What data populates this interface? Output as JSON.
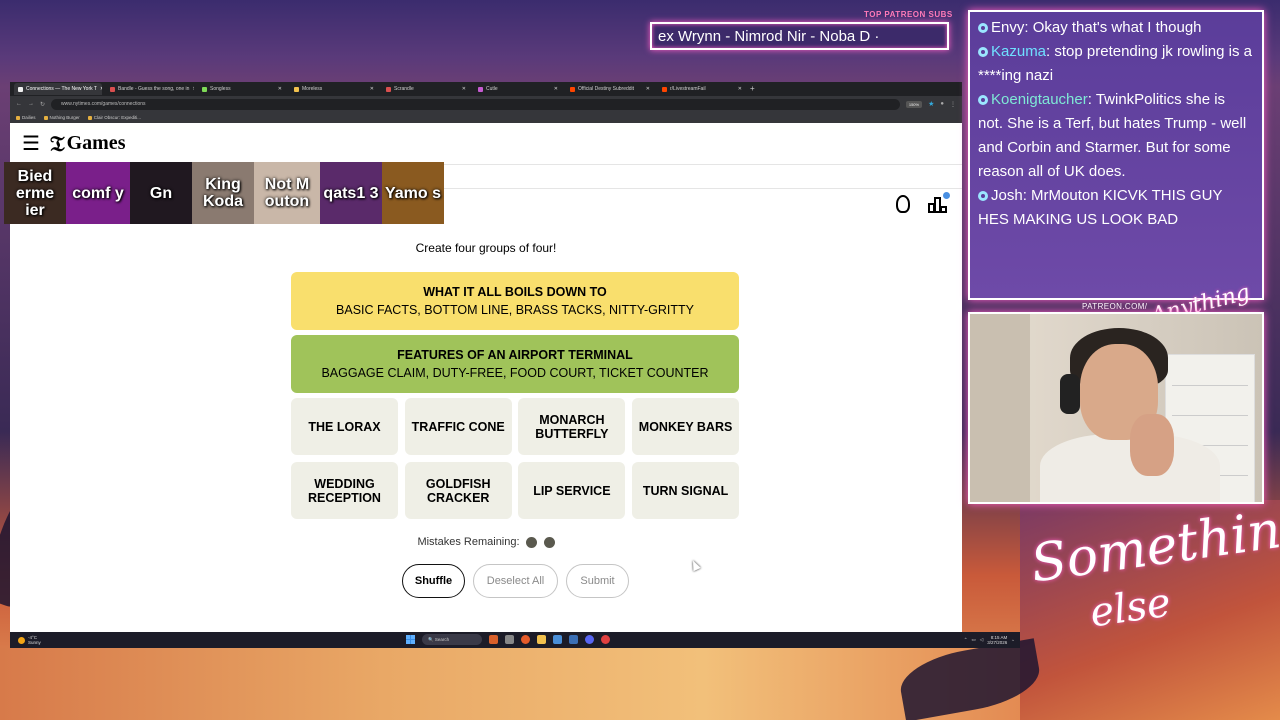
{
  "overlay": {
    "patreon_subs_label": "TOP PATREON SUBS",
    "marquee_text": "ex Wrynn - Nimrod Nir - Noba D ·",
    "patreon_url": "PATREON.COM/",
    "anything_logo": "Anything",
    "something_logo_1": "Something",
    "something_logo_2": "else"
  },
  "chat": [
    {
      "user": "Envy",
      "text": "Okay that's what I though"
    },
    {
      "user": "Kazuma",
      "text": "stop pretending jk rowling is a ****ing nazi"
    },
    {
      "user": "Koenigtaucher",
      "text": "TwinkPolitics she is not. She is a Terf, but hates Trump - well and Corbin and Starmer. But for some reason all of UK does."
    },
    {
      "user": "Josh",
      "text": "MrMouton KICVK THIS GUY HES MAKING US LOOK BAD"
    }
  ],
  "browser": {
    "tabs": [
      {
        "label": "Connections — The New York T",
        "color": "#f0f0f0",
        "active": true
      },
      {
        "label": "Bandle - Guess the song, one in",
        "color": "#d94f4f"
      },
      {
        "label": "Songless",
        "color": "#7ed957"
      },
      {
        "label": "Moreless",
        "color": "#f2c14e"
      },
      {
        "label": "Scrandle",
        "color": "#d94f4f"
      },
      {
        "label": "Cutle",
        "color": "#c65bd1"
      },
      {
        "label": "Official Destiny Subreddit",
        "color": "#ff4500"
      },
      {
        "label": "r/LivestreamFail",
        "color": "#ff4500"
      }
    ],
    "url": "www.nytimes.com/games/connections",
    "zoom": "150%",
    "bookmarks": [
      "Dailies",
      "Nothing Burger",
      "Clair Obscur: Expediti..."
    ]
  },
  "emotes": [
    {
      "label": "Bied erme ier",
      "bg": "#3b2a22",
      "width": 62
    },
    {
      "label": "comf y",
      "bg": "#7a1f8a",
      "width": 64
    },
    {
      "label": "Gn",
      "bg": "#201820",
      "width": 62
    },
    {
      "label": "King Koda",
      "bg": "#8a7a70",
      "width": 62
    },
    {
      "label": "Not M outon",
      "bg": "#c9b7a8",
      "width": 66
    },
    {
      "label": "qats1 3",
      "bg": "#5a2a6a",
      "width": 62
    },
    {
      "label": "Yamo s",
      "bg": "#8a5a20",
      "width": 62
    }
  ],
  "game": {
    "brand": "Games",
    "subtitle": "Create four groups of four!",
    "solved": [
      {
        "title": "What it all boils down to",
        "words": "Basic facts, bottom line, brass tacks, nitty-gritty",
        "color": "#f9df6d"
      },
      {
        "title": "Features of an airport terminal",
        "words": "Baggage claim, duty-free, food court, ticket counter",
        "color": "#a0c35a"
      }
    ],
    "cards": [
      "The Lorax",
      "Traffic Cone",
      "Monarch Butterfly",
      "Monkey Bars",
      "Wedding Reception",
      "Goldfish Cracker",
      "Lip Service",
      "Turn Signal"
    ],
    "mistakes_label": "Mistakes Remaining:",
    "mistakes_remaining": 2,
    "buttons": {
      "shuffle": "Shuffle",
      "deselect": "Deselect All",
      "submit": "Submit"
    }
  },
  "taskbar": {
    "weather_temp": "-4°C",
    "weather_cond": "Sunny",
    "search_placeholder": "Search",
    "time": "8:15 AM",
    "date": "3/27/2026"
  }
}
